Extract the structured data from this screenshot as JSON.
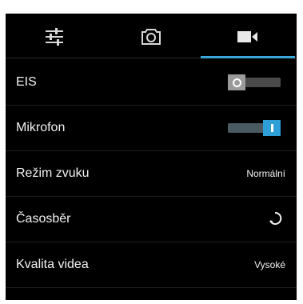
{
  "tabs": [
    {
      "icon": "sliders-icon",
      "active": false
    },
    {
      "icon": "camera-icon",
      "active": false
    },
    {
      "icon": "video-camera-icon",
      "active": true
    }
  ],
  "accent_color": "#3aa5d9",
  "settings": [
    {
      "label": "EIS",
      "control": "toggle",
      "state": "off"
    },
    {
      "label": "Mikrofon",
      "control": "toggle",
      "state": "on"
    },
    {
      "label": "Režim zvuku",
      "control": "value",
      "value": "Normální"
    },
    {
      "label": "Časosběr",
      "control": "icon",
      "icon": "timer-icon"
    },
    {
      "label": "Kvalita videa",
      "control": "value",
      "value": "Vysoké"
    }
  ]
}
